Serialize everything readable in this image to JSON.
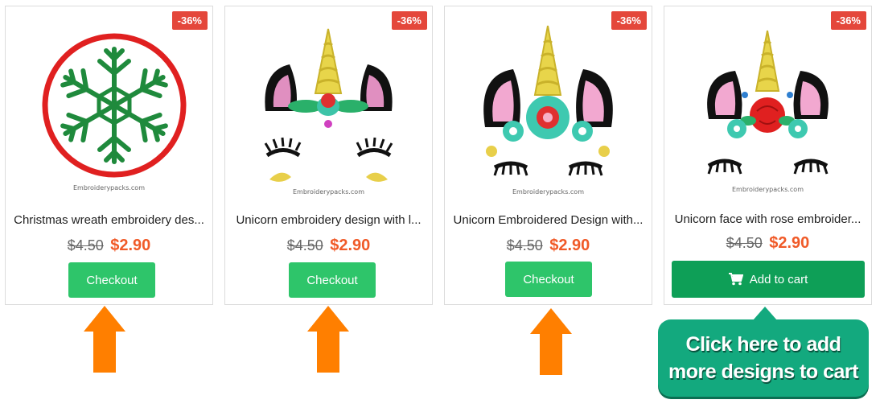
{
  "products": [
    {
      "badge": "-36%",
      "watermark": "Embroiderypacks.com",
      "title": "Christmas wreath embroidery des...",
      "old_price": "$4.50",
      "new_price": "$2.90",
      "button": "Checkout"
    },
    {
      "badge": "-36%",
      "watermark": "Embroiderypacks.com",
      "title": "Unicorn embroidery design with l...",
      "old_price": "$4.50",
      "new_price": "$2.90",
      "button": "Checkout"
    },
    {
      "badge": "-36%",
      "watermark": "Embroiderypacks.com",
      "title": "Unicorn Embroidered Design with...",
      "old_price": "$4.50",
      "new_price": "$2.90",
      "button": "Checkout"
    },
    {
      "badge": "-36%",
      "watermark": "Embroiderypacks.com",
      "title": "Unicorn face with rose embroider...",
      "old_price": "$4.50",
      "new_price": "$2.90",
      "button": "Add to cart",
      "button_icon": "cart-icon"
    }
  ],
  "callout": {
    "line1": "Click here to add",
    "line2": "more designs to cart"
  },
  "colors": {
    "badge": "#e4473b",
    "price": "#f05a28",
    "checkout": "#2ec56a",
    "add_to_cart": "#0e9f57",
    "arrow": "#ff7f00",
    "callout": "#13a97e"
  }
}
